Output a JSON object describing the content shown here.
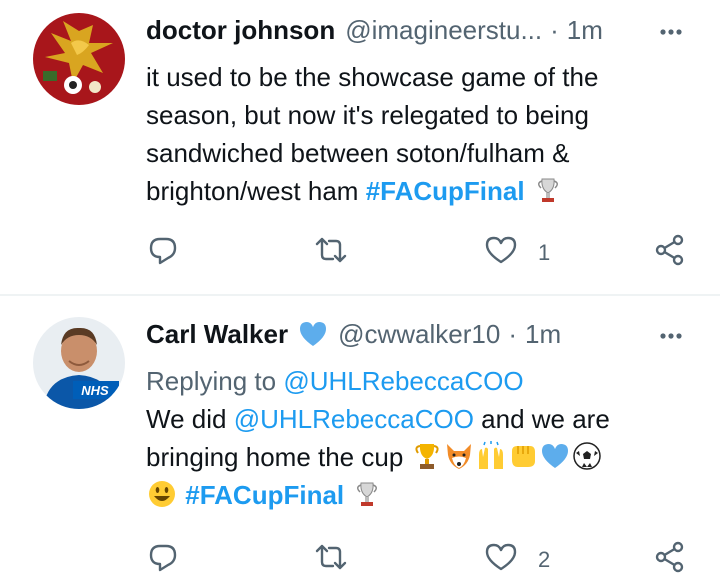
{
  "tweets": [
    {
      "name": "doctor johnson",
      "handle": "@imagineerstu...",
      "separator": "·",
      "time": "1m",
      "text": "it used to be the showcase game of the season, but now it's relegated to being sandwiched between soton/fulham & brighton/west ham",
      "hashtag": "#FACupFinal",
      "like_count": "1",
      "verified_emoji": false
    },
    {
      "name": "Carl Walker",
      "handle": "@cwwalker10",
      "separator": "·",
      "time": "1m",
      "replying_prefix": "Replying to",
      "replying_to": "@UHLRebeccaCOO",
      "text_start": "We did",
      "mention": "@UHLRebeccaCOO",
      "text_rest": " and we are bringing home the cup",
      "hashtag": "#FACupFinal",
      "like_count": "2",
      "avatar_badge": "NHS"
    }
  ],
  "icons": [
    "more-icon",
    "reply-icon",
    "retweet-icon",
    "like-icon",
    "share-icon",
    "blue-heart-icon",
    "fa-cup-trophy-icon",
    "trophy-icon",
    "fox-icon",
    "raising-hands-icon",
    "fist-icon",
    "soccer-ball-icon",
    "smiley-icon"
  ],
  "colors": {
    "link": "#1d9bf0",
    "secondary": "#536471",
    "text": "#0f1419"
  }
}
